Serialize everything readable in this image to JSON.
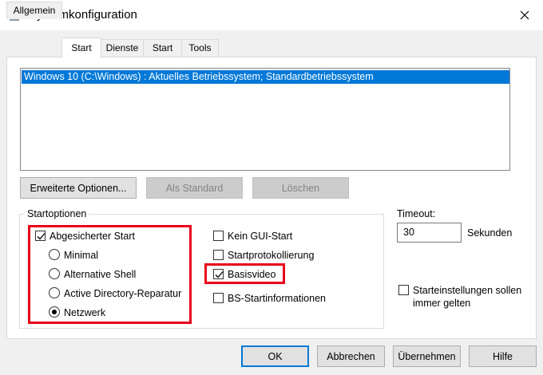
{
  "window": {
    "title": "Systemkonfiguration"
  },
  "tabs": [
    "Allgemein",
    "Start",
    "Dienste",
    "Start",
    "Tools"
  ],
  "os_list": {
    "items": [
      "Windows 10 (C:\\Windows) : Aktuelles Betriebssystem; Standardbetriebssystem"
    ]
  },
  "boot_buttons": {
    "advanced": "Erweiterte Optionen...",
    "set_default": "Als Standard",
    "delete": "Löschen"
  },
  "boot_options": {
    "group_label": "Startoptionen",
    "safe_boot": {
      "label": "Abgesicherter Start",
      "checked": true
    },
    "radios": [
      {
        "label": "Minimal",
        "selected": false
      },
      {
        "label": "Alternative Shell",
        "selected": false
      },
      {
        "label": "Active Directory-Reparatur",
        "selected": false
      },
      {
        "label": "Netzwerk",
        "selected": true
      }
    ],
    "right_checks": [
      {
        "label": "Kein GUI-Start",
        "checked": false
      },
      {
        "label": "Startprotokollierung",
        "checked": false
      },
      {
        "label": "Basisvideo",
        "checked": true
      },
      {
        "label": "BS-Startinformationen",
        "checked": false
      }
    ]
  },
  "timeout": {
    "label": "Timeout:",
    "value": "30",
    "unit": "Sekunden"
  },
  "permanent": {
    "label_line1": "Starteinstellungen sollen",
    "label_line2": "immer gelten",
    "checked": false
  },
  "footer_buttons": {
    "ok": "OK",
    "cancel": "Abbrechen",
    "apply": "Übernehmen",
    "help": "Hilfe"
  },
  "colors": {
    "selection": "#0078d7",
    "highlight_box": "#e8001c",
    "accent_border": "#0078d7"
  }
}
